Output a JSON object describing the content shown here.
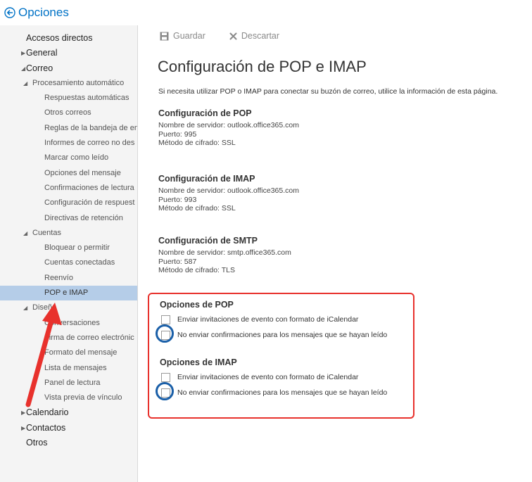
{
  "header": {
    "title": "Opciones"
  },
  "toolbar": {
    "save_label": "Guardar",
    "discard_label": "Descartar"
  },
  "sidebar": {
    "shortcuts": "Accesos directos",
    "general": "General",
    "mail": "Correo",
    "auto_processing": "Procesamiento automático",
    "auto_processing_items": [
      "Respuestas automáticas",
      "Otros correos",
      "Reglas de la bandeja de en",
      "Informes de correo no des",
      "Marcar como leído",
      "Opciones del mensaje",
      "Confirmaciones de lectura",
      "Configuración de respuest",
      "Directivas de retención"
    ],
    "accounts": "Cuentas",
    "accounts_items": [
      "Bloquear o permitir",
      "Cuentas conectadas",
      "Reenvío",
      "POP e IMAP"
    ],
    "layout": "Diseño",
    "layout_items": [
      "Conversaciones",
      "Firma de correo electrónic",
      "Formato del mensaje",
      "Lista de mensajes",
      "Panel de lectura",
      "Vista previa de vínculo"
    ],
    "calendar": "Calendario",
    "contacts": "Contactos",
    "other": "Otros"
  },
  "main": {
    "title": "Configuración de POP e IMAP",
    "intro": "Si necesita utilizar POP o IMAP para conectar su buzón de correo, utilice la información de esta página.",
    "pop": {
      "heading": "Configuración de POP",
      "server": "Nombre de servidor: outlook.office365.com",
      "port": "Puerto: 995",
      "encryption": "Método de cifrado: SSL"
    },
    "imap": {
      "heading": "Configuración de IMAP",
      "server": "Nombre de servidor: outlook.office365.com",
      "port": "Puerto: 993",
      "encryption": "Método de cifrado: SSL"
    },
    "smtp": {
      "heading": "Configuración de SMTP",
      "server": "Nombre de servidor: smtp.office365.com",
      "port": "Puerto: 587",
      "encryption": "Método de cifrado: TLS"
    },
    "pop_options": {
      "heading": "Opciones de POP",
      "icalendar": "Enviar invitaciones de evento con formato de iCalendar",
      "no_receipts": "No enviar confirmaciones para los mensajes que se hayan leído"
    },
    "imap_options": {
      "heading": "Opciones de IMAP",
      "icalendar": "Enviar invitaciones de evento con formato de iCalendar",
      "no_receipts": "No enviar confirmaciones para los mensajes que se hayan leído"
    }
  },
  "colors": {
    "accent": "#0072c6",
    "selected_nav": "#b5cde8",
    "annotation_box": "#e8312c",
    "annotation_circle": "#1a5fa8"
  },
  "icons": {
    "back": "back-arrow-circle-icon",
    "save": "floppy-disk-icon",
    "discard": "x-icon",
    "collapsed": "caret-right-icon",
    "expanded": "caret-down-icon"
  }
}
